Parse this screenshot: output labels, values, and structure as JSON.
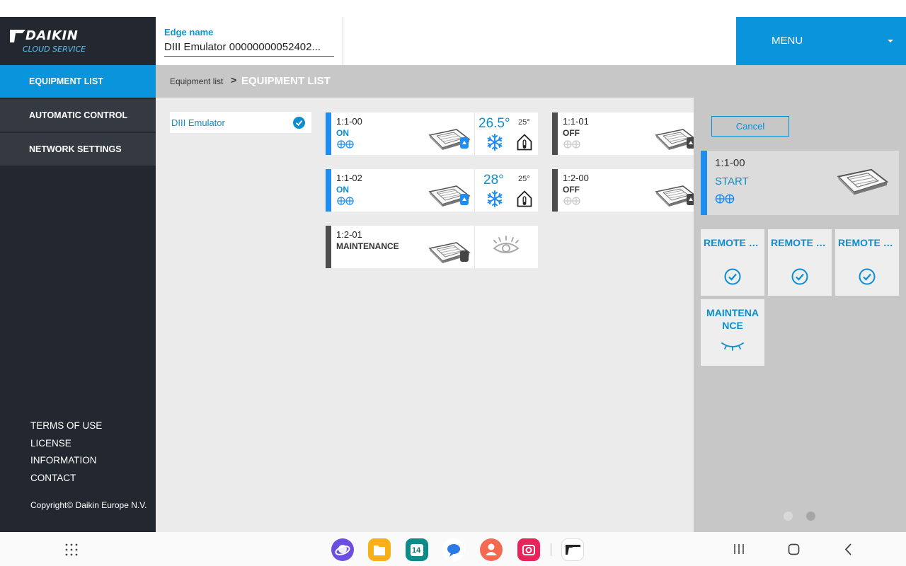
{
  "header": {
    "logo_text": "DAIKIN",
    "logo_sub": "CLOUD SERVICE",
    "edge_label": "Edge name",
    "edge_value": "DIII Emulator 00000000052402...",
    "menu_label": "MENU"
  },
  "sidebar": {
    "items": [
      {
        "label": "EQUIPMENT LIST"
      },
      {
        "label": "AUTOMATIC CONTROL"
      },
      {
        "label": "NETWORK SETTINGS"
      }
    ],
    "footer_links": [
      "TERMS OF USE",
      "LICENSE",
      "INFORMATION",
      "CONTACT"
    ],
    "copyright": "Copyright© Daikin Europe N.V."
  },
  "breadcrumb": {
    "previous": "Equipment list",
    "separator": ">",
    "current": "EQUIPMENT LIST"
  },
  "group": {
    "label": "DIII Emulator"
  },
  "equipment": [
    {
      "id": "1:1-00",
      "status": "ON",
      "temp": "26.5°",
      "setpoint": "25°"
    },
    {
      "id": "1:1-01",
      "status": "OFF"
    },
    {
      "id": "1:1-02",
      "status": "ON",
      "temp": "28°",
      "setpoint": "25°"
    },
    {
      "id": "1:2-00",
      "status": "OFF"
    },
    {
      "id": "1:2-01",
      "status": "MAINTENANCE"
    }
  ],
  "panel": {
    "cancel_label": "Cancel",
    "selected": {
      "id": "1:1-00",
      "status": "START"
    },
    "actions": [
      {
        "label": "REMOTE CONTROL..."
      },
      {
        "label": "REMOTE CONTROL..."
      },
      {
        "label": "REMOTE CONTROL..."
      },
      {
        "label": "MAINTENANCE"
      }
    ]
  },
  "colors": {
    "accent": "#0a94dc",
    "sidebar_bg": "#23272f",
    "status_on": "#1f8cf0",
    "status_off": "#4d4d4d"
  },
  "navbar": {
    "apps": [
      "internet-app",
      "files-app",
      "calendar-app",
      "messages-app",
      "contacts-app",
      "camera-app",
      "daikin-app"
    ],
    "calendar_day": "14"
  }
}
